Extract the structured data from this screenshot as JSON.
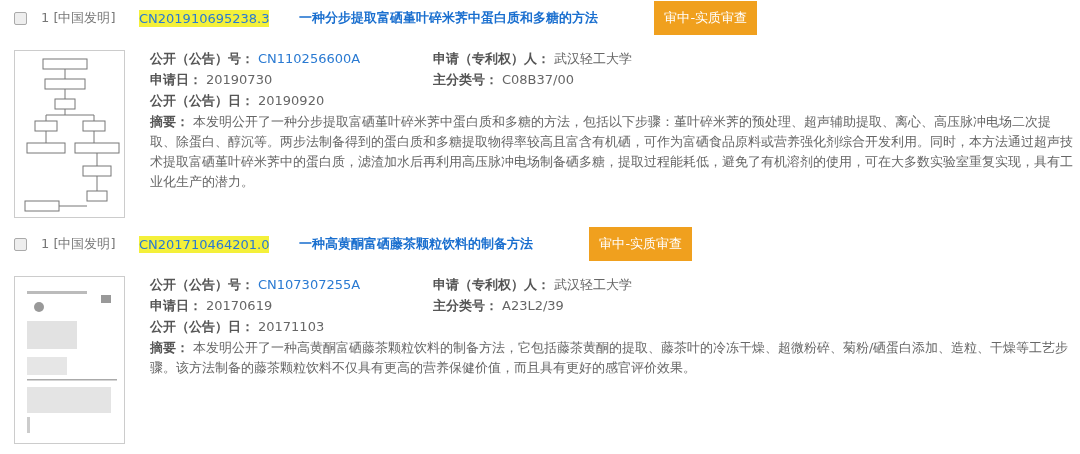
{
  "records": [
    {
      "checked": false,
      "index": "1 [中国发明]",
      "application_no": "CN201910695238.3",
      "title": "一种分步提取富硒堇叶碎米荠中蛋白质和多糖的方法",
      "status": "审中-实质审查",
      "fields": [
        {
          "label": "公开（公告）号：",
          "value": "CN110256600A",
          "kind": "link"
        },
        {
          "label": "申请（专利权）人：",
          "value": "武汉轻工大学",
          "kind": "text"
        },
        {
          "label": "申请日：",
          "value": "20190730",
          "kind": "text"
        },
        {
          "label": "主分类号：",
          "value": "C08B37/00",
          "kind": "text"
        },
        {
          "label": "公开（公告）日：",
          "value": "20190920",
          "kind": "text"
        }
      ],
      "abstract": "**摘要：** 本发明公开了一种分步提取富硒堇叶碎米荠中蛋白质和多糖的方法，包括以下步骤：堇叶碎米荠的预处理、超声辅助提取、离心、高压脉冲电场二次提取、除蛋白、醇沉等。两步法制备得到的蛋白质和多糖提取物得率较高且富含有机硒，可作为富硒食品原料或营养强化剂综合开发利用。同时，本方法通过超声技术提取富硒堇叶碎米荠中的蛋白质，滤渣加水后再利用高压脉冲电场制备硒多糖，提取过程能耗低，避免了有机溶剂的使用，可在大多数实验室重复实现，具有工业化生产的潜力。"
    },
    {
      "checked": false,
      "index": "1 [中国发明]",
      "application_no": "CN201710464201.0",
      "title": "一种高黄酮富硒藤茶颗粒饮料的制备方法",
      "status": "审中-实质审查",
      "fields": [
        {
          "label": "公开（公告）号：",
          "value": "CN107307255A",
          "kind": "link"
        },
        {
          "label": "申请（专利权）人：",
          "value": "武汉轻工大学",
          "kind": "text"
        },
        {
          "label": "申请日：",
          "value": "20170619",
          "kind": "text"
        },
        {
          "label": "主分类号：",
          "value": "A23L2/39",
          "kind": "text"
        },
        {
          "label": "公开（公告）日：",
          "value": "20171103",
          "kind": "text"
        }
      ],
      "abstract": "**摘要：** 本发明公开了一种高黄酮富硒藤茶颗粒饮料的制备方法，它包括藤茶黄酮的提取、藤茶叶的冷冻干燥、超微粉碎、菊粉/硒蛋白添加、造粒、干燥等工艺步骤。该方法制备的藤茶颗粒饮料不仅具有更高的营养保健价值，而且具有更好的感官评价效果。"
    }
  ]
}
